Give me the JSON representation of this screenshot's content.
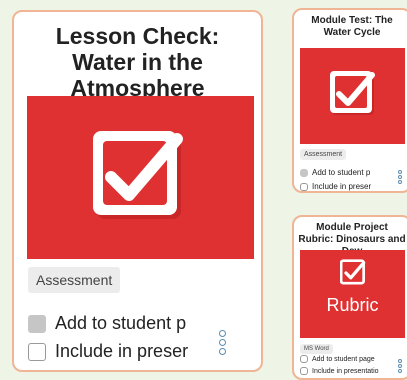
{
  "cards": [
    {
      "title": "Lesson Check: Water in the Atmosphere",
      "thumbnail_icon": "checkbox-check-icon",
      "tag": "Assessment",
      "options": [
        "Add to student p",
        "Include in preser"
      ],
      "more_icon": "more-options-icon"
    },
    {
      "title": "Module Test: The Water Cycle",
      "thumbnail_icon": "checkbox-check-icon",
      "tag": "Assessment",
      "options": [
        "Add to student p",
        "Include in preser"
      ],
      "more_icon": "more-options-icon"
    },
    {
      "title": "Module Project Rubric: Dinosaurs and Dew",
      "thumbnail_icon": "checkbox-check-icon",
      "thumbnail_text": "Rubric",
      "tag": "MS Word",
      "options": [
        "Add to student page",
        "Include in presentatio"
      ],
      "more_icon": "more-options-icon"
    }
  ],
  "colors": {
    "accent_red": "#df3131",
    "card_border": "#f0b594",
    "background": "#eef4e6",
    "dots": "#5b8db0"
  }
}
